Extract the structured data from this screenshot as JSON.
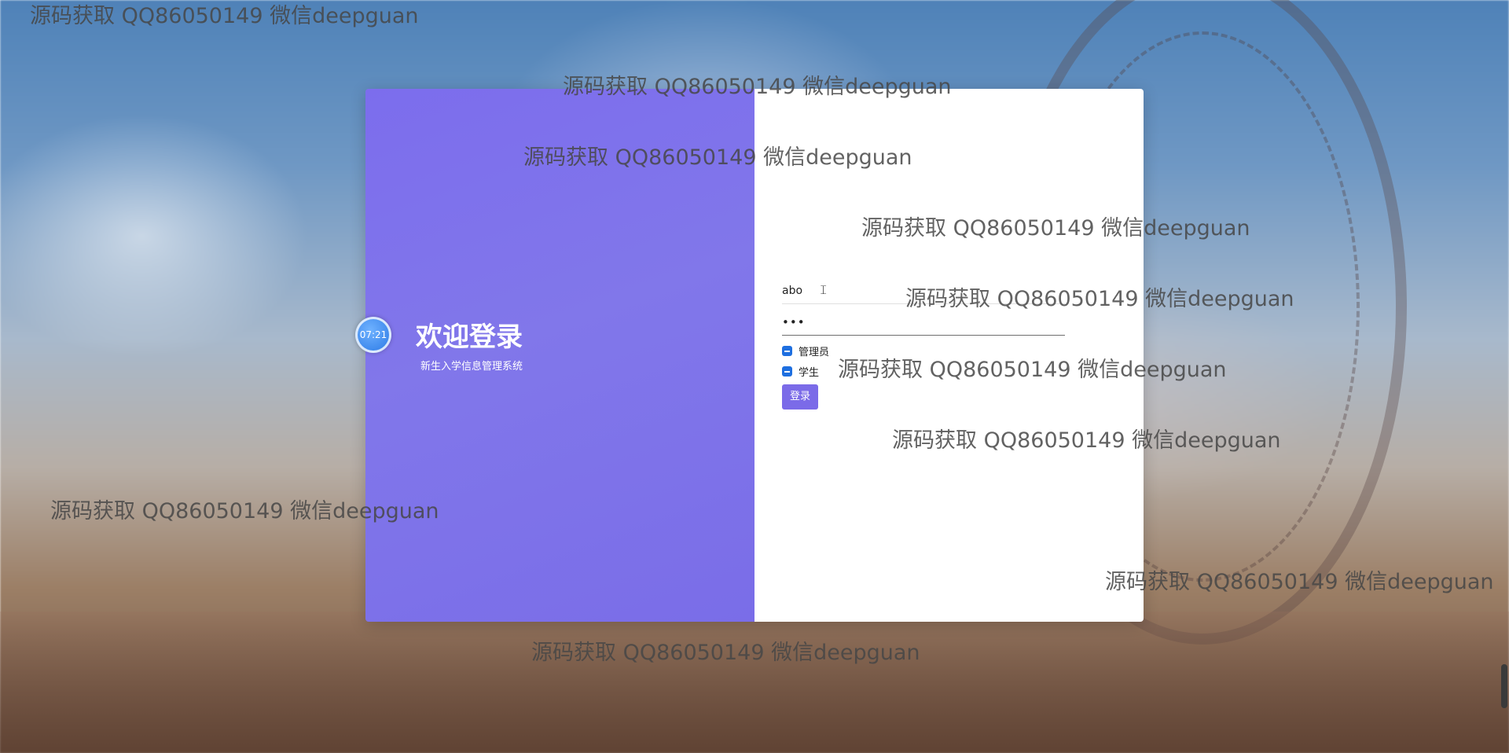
{
  "welcome": {
    "title": "欢迎登录",
    "subtitle": "新生入学信息管理系统"
  },
  "clock": {
    "time": "07:21"
  },
  "form": {
    "username_value": "abo",
    "password_value": "•••",
    "roles": [
      {
        "label": "管理员",
        "checked": true
      },
      {
        "label": "学生",
        "checked": true
      }
    ],
    "login_label": "登录"
  },
  "watermark": {
    "text": "源码获取 QQ86050149 微信deepguan"
  },
  "colors": {
    "accent": "#7b6be8",
    "panel": "#7c6ded",
    "checkbox": "#1e6fe0"
  }
}
